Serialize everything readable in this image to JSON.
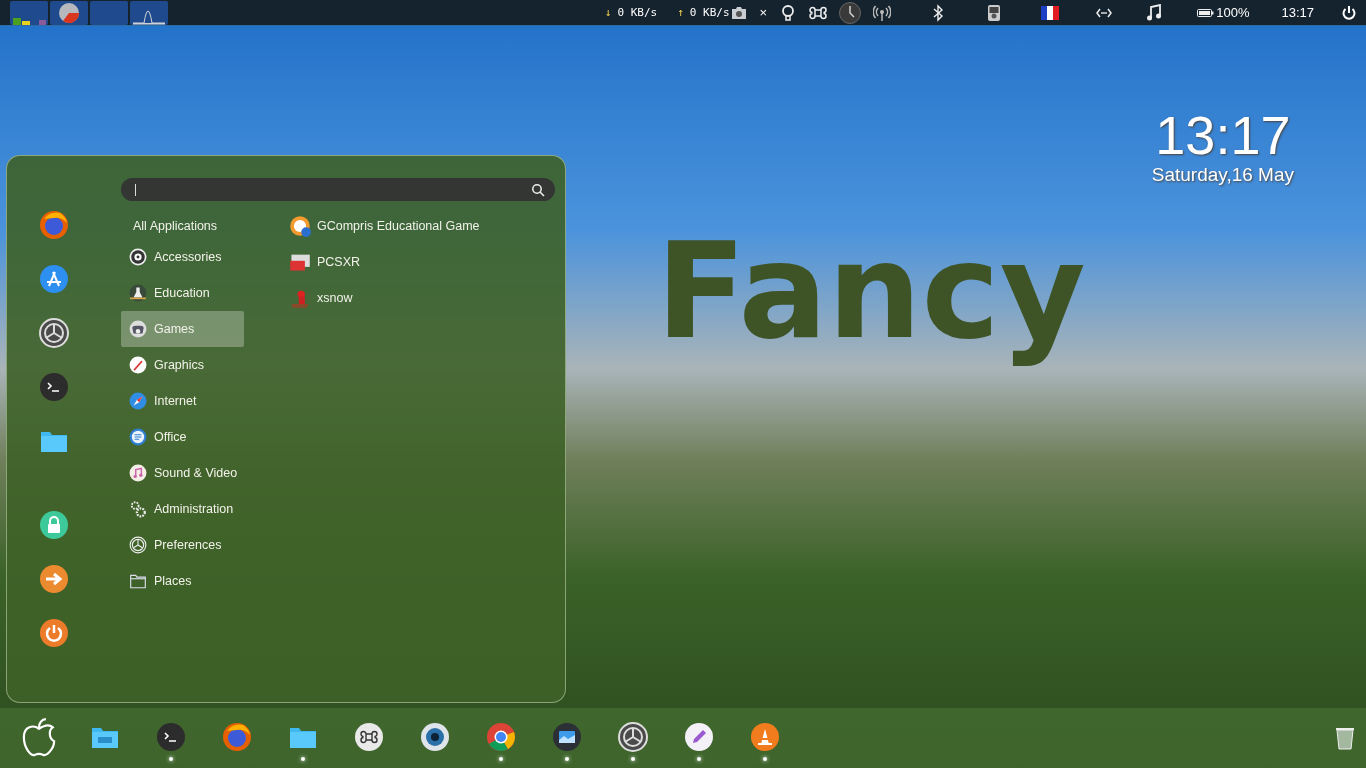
{
  "top_panel": {
    "network": [
      {
        "arrow": "↓",
        "value": "0 KB/s"
      },
      {
        "arrow": "↑",
        "value": "0 KB/s"
      }
    ],
    "close_mark": "×",
    "battery": "100%",
    "time": "13:17"
  },
  "desktop": {
    "clock_time": "13:17",
    "clock_date": "Saturday,16 May",
    "overlay_text": "Fancy"
  },
  "menu": {
    "categories": [
      {
        "kind": "all",
        "label": "All Applications",
        "selected": false
      },
      {
        "kind": "category",
        "label": "Accessories",
        "selected": false
      },
      {
        "kind": "category",
        "label": "Education",
        "selected": false
      },
      {
        "kind": "category",
        "label": "Games",
        "selected": true
      },
      {
        "kind": "category",
        "label": "Graphics",
        "selected": false
      },
      {
        "kind": "category",
        "label": "Internet",
        "selected": false
      },
      {
        "kind": "category",
        "label": "Office",
        "selected": false
      },
      {
        "kind": "category",
        "label": "Sound & Video",
        "selected": false
      },
      {
        "kind": "category",
        "label": "Administration",
        "selected": false
      },
      {
        "kind": "category",
        "label": "Preferences",
        "selected": false
      },
      {
        "kind": "category",
        "label": "Places",
        "selected": false
      }
    ],
    "apps": [
      "GCompris Educational Game",
      "PCSXR",
      "xsnow"
    ]
  },
  "dock": {
    "launchers": [
      {
        "running": false
      },
      {
        "running": false
      },
      {
        "running": true
      },
      {
        "running": false
      },
      {
        "running": true
      },
      {
        "running": false
      },
      {
        "running": false
      },
      {
        "running": true
      },
      {
        "running": true
      },
      {
        "running": true
      },
      {
        "running": true
      },
      {
        "running": true
      }
    ]
  }
}
